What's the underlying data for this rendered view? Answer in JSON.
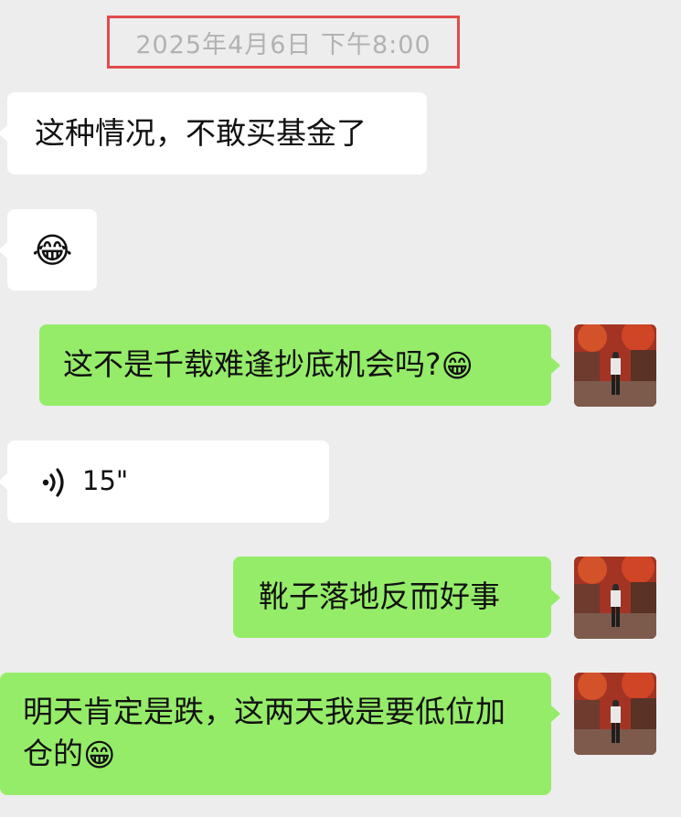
{
  "chat": {
    "timestamp": "2025年4月6日 下午8:00",
    "messages": [
      {
        "side": "left",
        "type": "text",
        "text": "这种情况，不敢买基金了"
      },
      {
        "side": "left",
        "type": "emoji",
        "emoji": "😂",
        "icon": "facepalm-crying-emoji"
      },
      {
        "side": "right",
        "type": "text",
        "text": "这不是千载难逢抄底机会吗?",
        "emoji": "😁"
      },
      {
        "side": "left",
        "type": "voice",
        "duration": "15\""
      },
      {
        "side": "right",
        "type": "text",
        "text": "靴子落地反而好事"
      },
      {
        "side": "right",
        "type": "text",
        "text": "明天肯定是跌，这两天我是要低位加仓的",
        "emoji": "😁"
      }
    ]
  },
  "colors": {
    "background": "#ededed",
    "incoming_bubble": "#ffffff",
    "outgoing_bubble": "#95ec69",
    "timestamp_text": "#b2b2b2",
    "highlight_border": "#e24b4b"
  }
}
